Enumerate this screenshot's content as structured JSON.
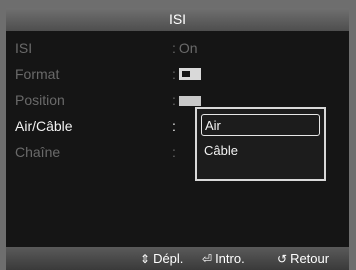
{
  "menu": {
    "title": "ISI",
    "rows": [
      {
        "label": "ISI",
        "colon": ":",
        "value": "On"
      },
      {
        "label": "Format",
        "colon": ":",
        "value": ""
      },
      {
        "label": "Position",
        "colon": ":",
        "value": ""
      },
      {
        "label": "Air/Câble",
        "colon": ":",
        "value": ""
      },
      {
        "label": "Chaîne",
        "colon": ":",
        "value": ""
      }
    ],
    "dropdown": {
      "options": [
        "Air",
        "Câble"
      ],
      "selected": "Air"
    }
  },
  "footer": {
    "move": {
      "icon": "⇕",
      "label": "Dépl."
    },
    "enter": {
      "icon": "⏎",
      "label": "Intro."
    },
    "return": {
      "icon": "↺",
      "label": "Retour"
    }
  },
  "colors": {
    "panel_bg": "#151515",
    "active_text": "#f2f2f2",
    "inactive_text": "#6a6a6a"
  }
}
